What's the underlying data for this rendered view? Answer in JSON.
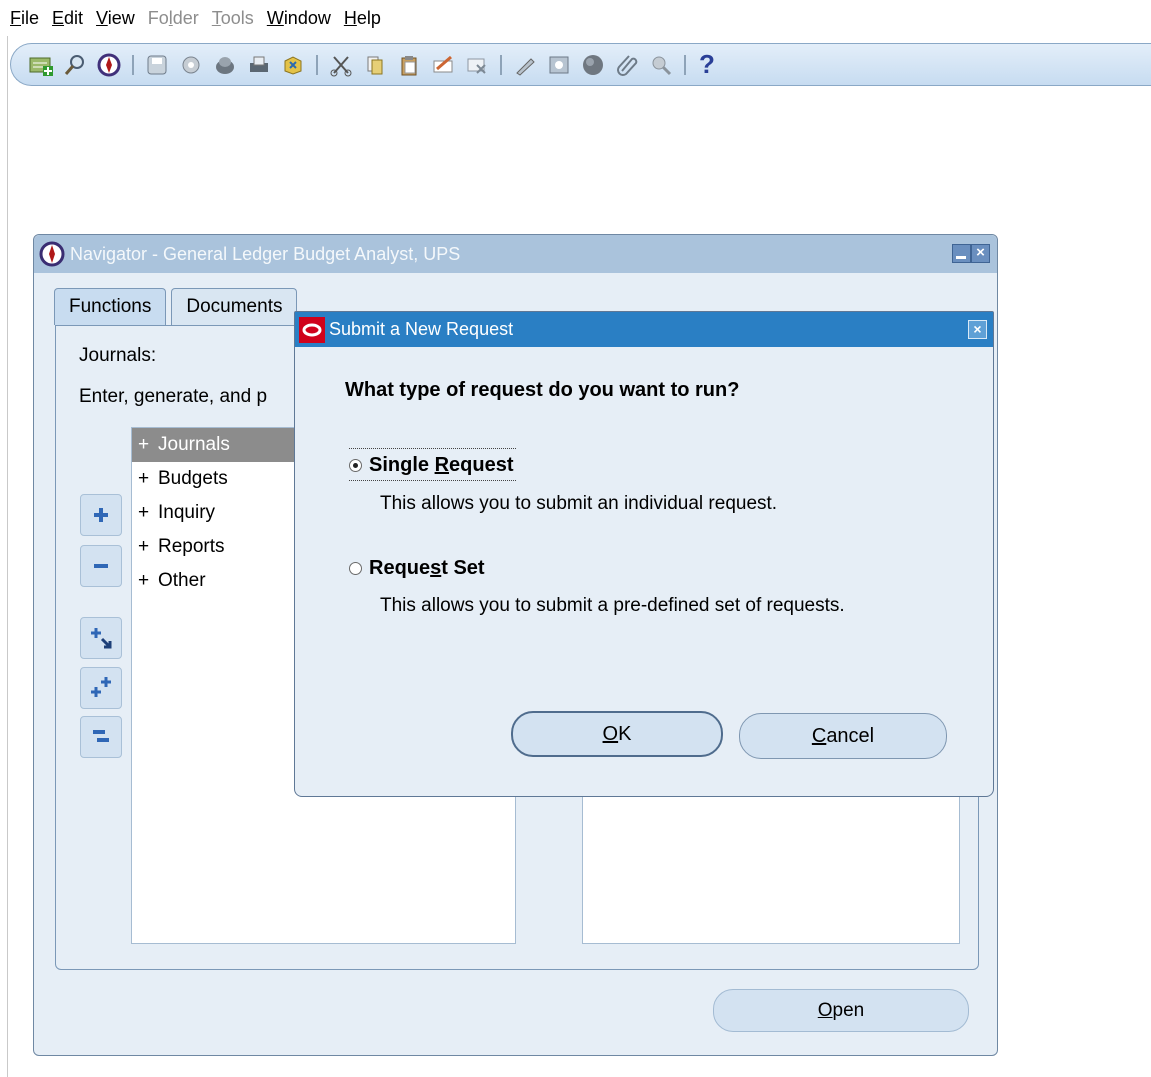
{
  "menubar": {
    "items": [
      {
        "label": "File",
        "mnemonic": "F",
        "disabled": false
      },
      {
        "label": "Edit",
        "mnemonic": "E",
        "disabled": false
      },
      {
        "label": "View",
        "mnemonic": "V",
        "disabled": false
      },
      {
        "label": "Folder",
        "mnemonic": "l",
        "disabled": true
      },
      {
        "label": "Tools",
        "mnemonic": "T",
        "disabled": true
      },
      {
        "label": "Window",
        "mnemonic": "W",
        "disabled": false
      },
      {
        "label": "Help",
        "mnemonic": "H",
        "disabled": false
      }
    ]
  },
  "toolbar": {
    "help_glyph": "?",
    "icons": [
      "new-record-icon",
      "find-icon",
      "navigator-icon",
      "save-icon",
      "next-step-icon",
      "switch-responsibility-icon",
      "print-icon",
      "close-form-icon",
      "cut-icon",
      "copy-icon",
      "paste-icon",
      "clear-record-icon",
      "delete-record-icon",
      "edit-field-icon",
      "zoom-icon",
      "translations-icon",
      "attachments-icon",
      "folder-tools-icon"
    ]
  },
  "navigator": {
    "title": "Navigator - General Ledger Budget Analyst, UPS",
    "tabs": [
      {
        "label": "Functions",
        "active": true
      },
      {
        "label": "Documents",
        "active": false
      }
    ],
    "section_label": "Journals:",
    "description": "Enter, generate, and p",
    "tree": [
      {
        "prefix": "+",
        "label": "Journals",
        "selected": true
      },
      {
        "prefix": "+",
        "label": "Budgets",
        "selected": false
      },
      {
        "prefix": "+",
        "label": "Inquiry",
        "selected": false
      },
      {
        "prefix": "+",
        "label": "Reports",
        "selected": false
      },
      {
        "prefix": "+",
        "label": "Other",
        "selected": false
      }
    ],
    "open_button": {
      "label": "Open",
      "mnemonic": "O"
    }
  },
  "dialog": {
    "title": "Submit a New Request",
    "question": "What type of request do you want to run?",
    "options": [
      {
        "label": "Single Request",
        "mnemonic": "R",
        "checked": true,
        "description": "This allows you to submit an individual request."
      },
      {
        "label": "Request Set",
        "mnemonic": "s",
        "checked": false,
        "description": "This allows you to submit a pre-defined set of requests."
      }
    ],
    "ok_button": {
      "label": "OK",
      "mnemonic": "O"
    },
    "cancel_button": {
      "label": "Cancel",
      "mnemonic": "C"
    }
  },
  "colors": {
    "dialog_titlebar": "#2a7fc4",
    "navigator_titlebar": "#aac3dc",
    "oracle_red": "#d0021b",
    "window_bg": "#e6eef6"
  }
}
